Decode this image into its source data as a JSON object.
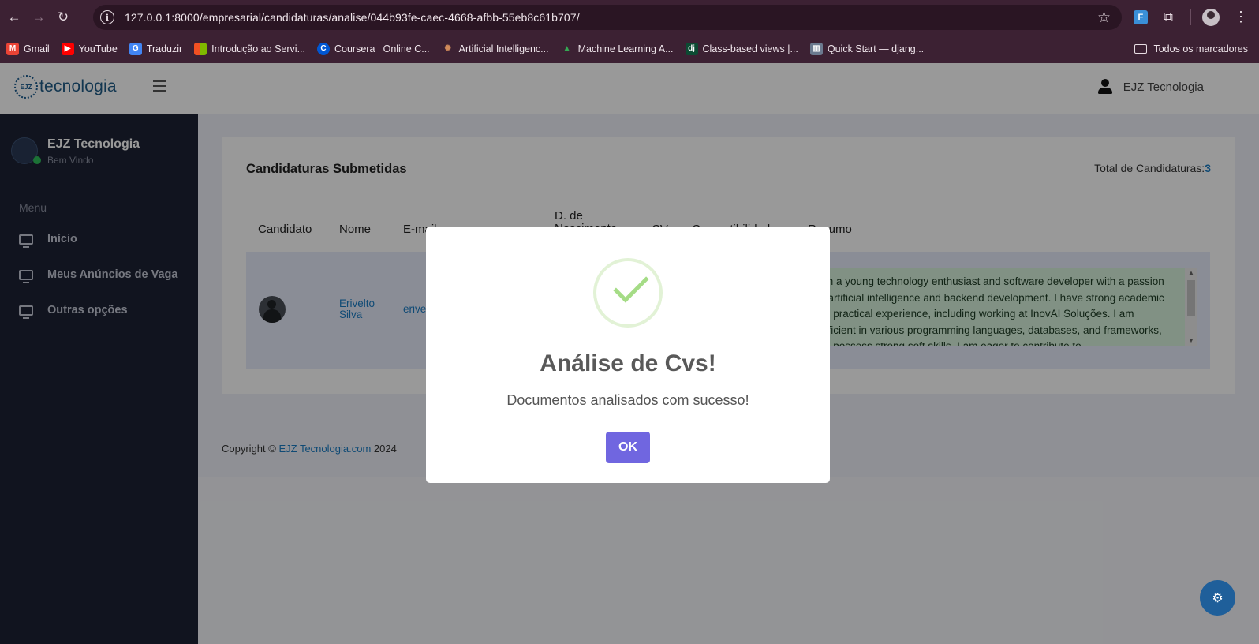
{
  "browser": {
    "url": "127.0.0.1:8000/empresarial/candidaturas/analise/044b93fe-caec-4668-afbb-55eb8c61b707/",
    "bookmarks": [
      {
        "label": "Gmail",
        "color": "#ea4335",
        "glyph": "M"
      },
      {
        "label": "YouTube",
        "color": "#ff0000",
        "glyph": "▶"
      },
      {
        "label": "Traduzir",
        "color": "#4285f4",
        "glyph": "G"
      },
      {
        "label": "Introdução ao Servi...",
        "color": "#f25022",
        "glyph": "■"
      },
      {
        "label": "Coursera | Online C...",
        "color": "#0056d2",
        "glyph": "C"
      },
      {
        "label": "Artificial Intelligenc...",
        "color": "#b0603a",
        "glyph": "✺"
      },
      {
        "label": "Machine Learning A...",
        "color": "#34a853",
        "glyph": "▲"
      },
      {
        "label": "Class-based views |...",
        "color": "#0c4b33",
        "glyph": "dj"
      },
      {
        "label": "Quick Start — djang...",
        "color": "#6b7a8f",
        "glyph": "▥"
      }
    ],
    "all_bookmarks": "Todos os marcadores"
  },
  "header": {
    "logo_text": "tecnologia",
    "logo_mark": "EJZ",
    "user_name": "EJZ Tecnologia"
  },
  "sidebar": {
    "brand_name": "EJZ Tecnologia",
    "welcome": "Bem Vindo",
    "menu_label": "Menu",
    "items": [
      {
        "label": "Início"
      },
      {
        "label": "Meus Anúncios de Vaga"
      },
      {
        "label": "Outras opções"
      }
    ]
  },
  "card": {
    "title": "Candidaturas Submetidas",
    "total_label": "Total de Candidaturas:",
    "total_value": "3",
    "columns": [
      "Candidato",
      "Nome",
      "E-mail",
      "D. de Nascimento",
      "CV",
      "Compatibilidade",
      "Resumo"
    ],
    "row": {
      "name": "Erivelto Silva",
      "email": "erivelto",
      "resume": "I am a young technology enthusiast and software developer with a passion for artificial intelligence and backend development. I have strong academic and practical experience, including working at InovAI Soluções. I am proficient in various programming languages, databases, and frameworks, and possess strong soft skills. I am eager to contribute to"
    }
  },
  "footer": {
    "prefix": "Copyright © ",
    "link": "EJZ Tecnologia.com",
    "year": " 2024"
  },
  "modal": {
    "title": "Análise de Cvs!",
    "text": "Documentos analisados com sucesso!",
    "ok_label": "OK"
  }
}
